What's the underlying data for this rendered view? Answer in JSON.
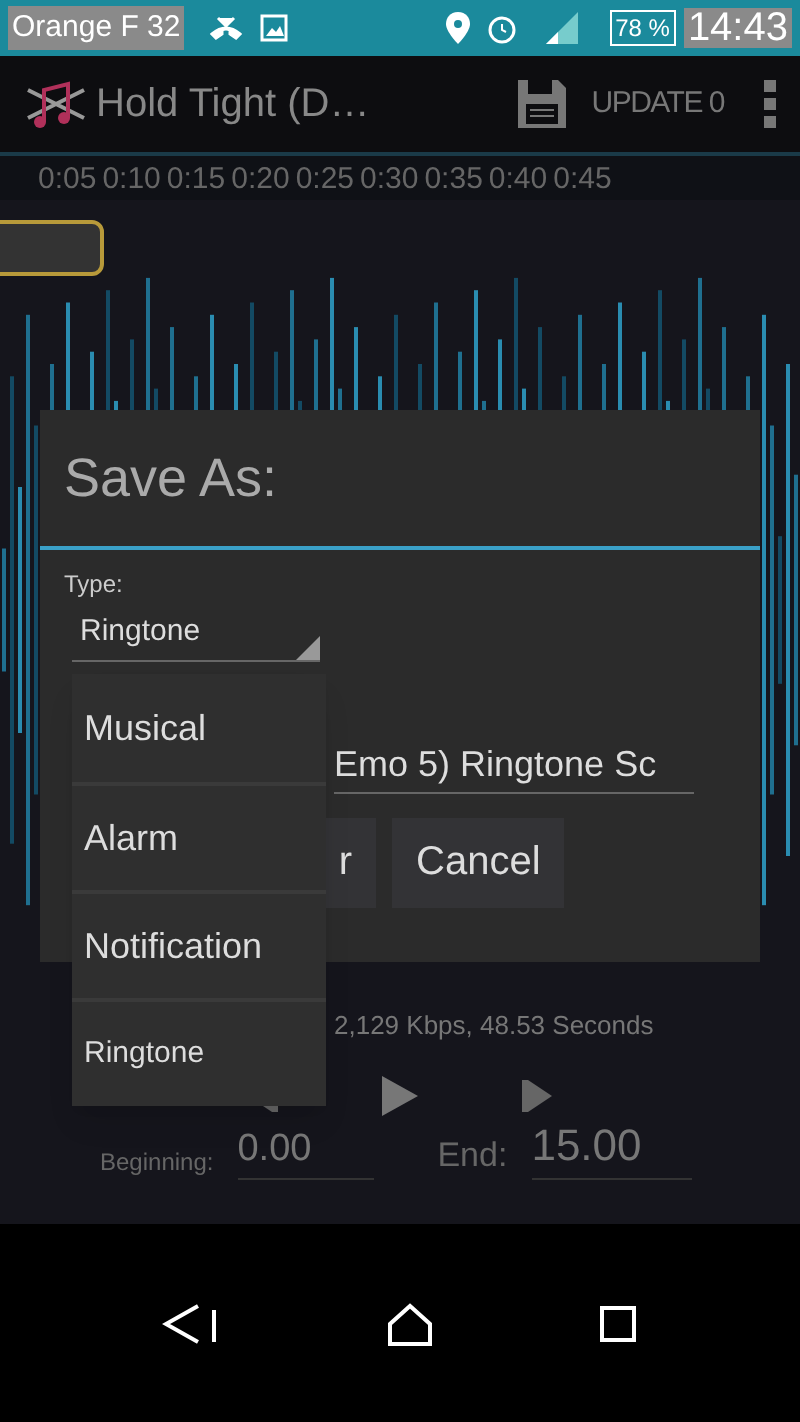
{
  "status_bar": {
    "carrier": "Orange F 32",
    "battery": "78 %",
    "time": "14:43"
  },
  "action_bar": {
    "title": "Hold Tight (D…",
    "update": "UPDATE 0"
  },
  "timeline": [
    "0:05",
    "0:10",
    "0:15",
    "0:20",
    "0:25",
    "0:30",
    "0:35",
    "0:40",
    "0:45"
  ],
  "dialog": {
    "title": "Save As:",
    "type_label": "Type:",
    "type_value": "Ringtone",
    "filename": "Emo 5) Ringtone Sc",
    "buttons": [
      "r",
      "Cancel"
    ]
  },
  "dropdown": {
    "items": [
      "Musical",
      "Alarm",
      "Notification",
      "Ringtone"
    ]
  },
  "info": "2,129 Kbps, 48.53 Seconds",
  "range": {
    "beginning_label": "Beginning:",
    "beginning": "0.00",
    "end_label": "End:",
    "end": "15.00"
  }
}
